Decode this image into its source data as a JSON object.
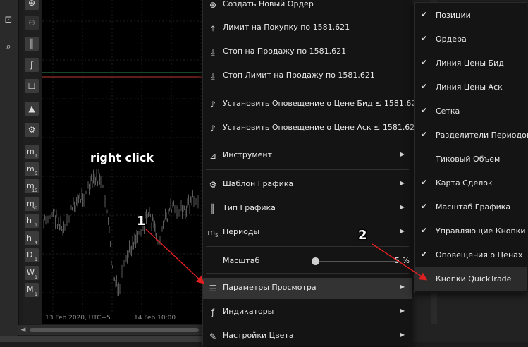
{
  "annotations": {
    "right_click": "right click",
    "step1": "1",
    "step2": "2"
  },
  "chart": {
    "x_labels": [
      "13 Feb 2020, UTC+5",
      "14 Feb 10:00"
    ]
  },
  "left_tools": {
    "periods": [
      {
        "main": "m",
        "sub": "1"
      },
      {
        "main": "m",
        "sub": "5"
      },
      {
        "main": "m",
        "sub": "15"
      },
      {
        "main": "m",
        "sub": "30"
      },
      {
        "main": "h",
        "sub": "1"
      },
      {
        "main": "h",
        "sub": "4"
      },
      {
        "main": "D",
        "sub": "1"
      },
      {
        "main": "W",
        "sub": "1"
      },
      {
        "main": "M",
        "sub": "1"
      }
    ]
  },
  "context_menu": {
    "create_order": "Создать Новый Ордер",
    "buy_limit": "Лимит на Покупку по 1581.621",
    "sell_stop": "Стоп на Продажу по 1581.621",
    "sell_stop_limit": "Стоп Лимит на Продажу по 1581.621",
    "alert_bid": "Установить Оповещение о Цене Бид ≤ 1581.621",
    "alert_ask": "Установить Оповещение о Цене Аск ≤ 1581.621",
    "instrument": "Инструмент",
    "chart_template": "Шаблон Графика",
    "chart_type": "Тип Графика",
    "periods": "Периоды",
    "periods_icon_main": "m",
    "periods_icon_sub": "5",
    "zoom_label": "Масштаб",
    "zoom_value": "5 %",
    "view_options": "Параметры Просмотра",
    "indicators": "Индикаторы",
    "color_settings": "Настройки Цвета"
  },
  "submenu": {
    "items": [
      {
        "label": "Позиции",
        "checked": true
      },
      {
        "label": "Ордера",
        "checked": true
      },
      {
        "label": "Линия Цены Бид",
        "checked": true
      },
      {
        "label": "Линия Цены Аск",
        "checked": true
      },
      {
        "label": "Сетка",
        "checked": true
      },
      {
        "label": "Разделители Периодов",
        "checked": true
      },
      {
        "label": "Тиковый Объем",
        "checked": false
      },
      {
        "label": "Карта Сделок",
        "checked": true
      },
      {
        "label": "Масштаб Графика",
        "checked": true
      },
      {
        "label": "Управляющие Кнопки",
        "checked": true
      },
      {
        "label": "Оповещения о Ценах",
        "checked": true
      },
      {
        "label": "Кнопки QuickTrade",
        "checked": false
      }
    ]
  },
  "colors": {
    "bid_line": "#2e8b57",
    "ask_line": "#c0392b",
    "arrow": "#e02020",
    "menu_bg": "#141414",
    "highlight": "#333333"
  }
}
